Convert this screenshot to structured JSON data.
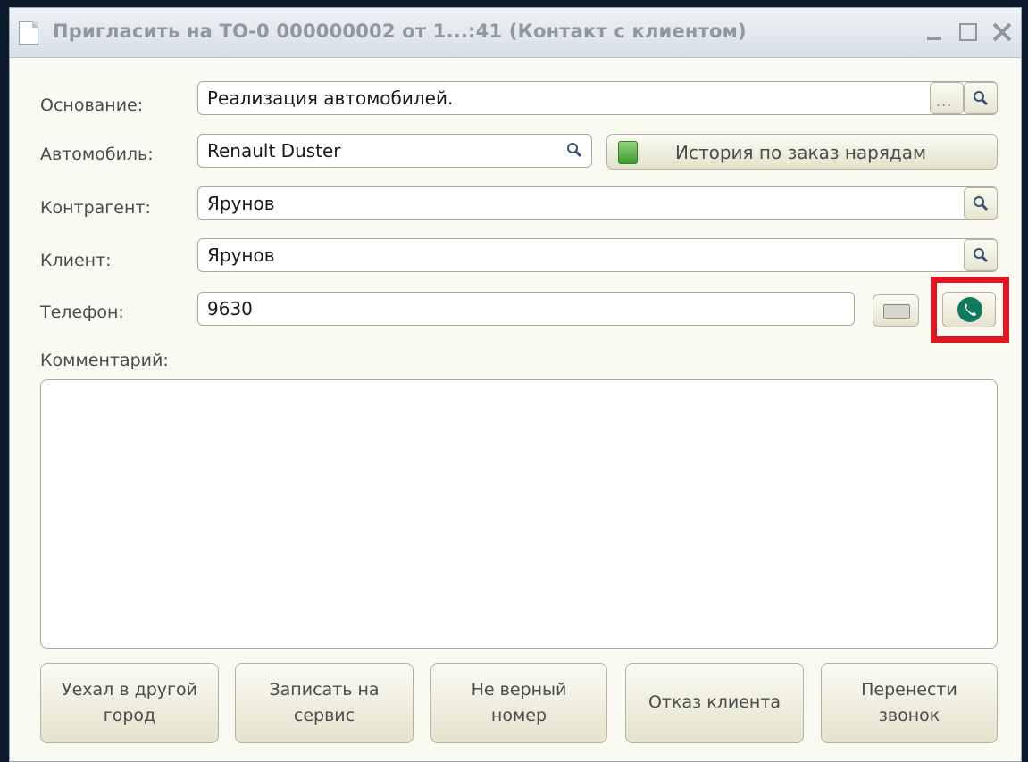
{
  "window": {
    "title": "Пригласить на ТО-0 000000002 от 1...:41 (Контакт с клиентом)",
    "controls": [
      "minimize-icon",
      "maximize-icon",
      "close-icon"
    ]
  },
  "form": {
    "basis_label": "Основание:",
    "basis_value": "Реализация автомобилей.",
    "car_label": "Автомобиль:",
    "car_value": "Renault Duster",
    "history_button": "История по заказ нарядам",
    "counterparty_label": "Контрагент:",
    "counterparty_value": "Ярунов",
    "client_label": "Клиент:",
    "client_value": "Ярунов",
    "phone_label": "Телефон:",
    "phone_value": "9630",
    "comment_label": "Комментарий:",
    "comment_value": ""
  },
  "actions": [
    {
      "line1": "Уехал в другой",
      "line2": "город"
    },
    {
      "line1": "Записать на",
      "line2": "сервис"
    },
    {
      "line1": "Не верный",
      "line2": "номер"
    },
    {
      "line1": "Отказ клиента",
      "line2": ""
    },
    {
      "line1": "Перенести",
      "line2": "звонок"
    }
  ],
  "colors": {
    "highlight": "#e01622",
    "phone_icon": "#0f7a60",
    "background": "#0d1a2c"
  },
  "icons": {
    "search": "magnifier-icon",
    "ellipsis": "ellipsis-icon",
    "history": "document-icon",
    "keyboard": "keyboard-icon",
    "phone": "phone-icon"
  }
}
